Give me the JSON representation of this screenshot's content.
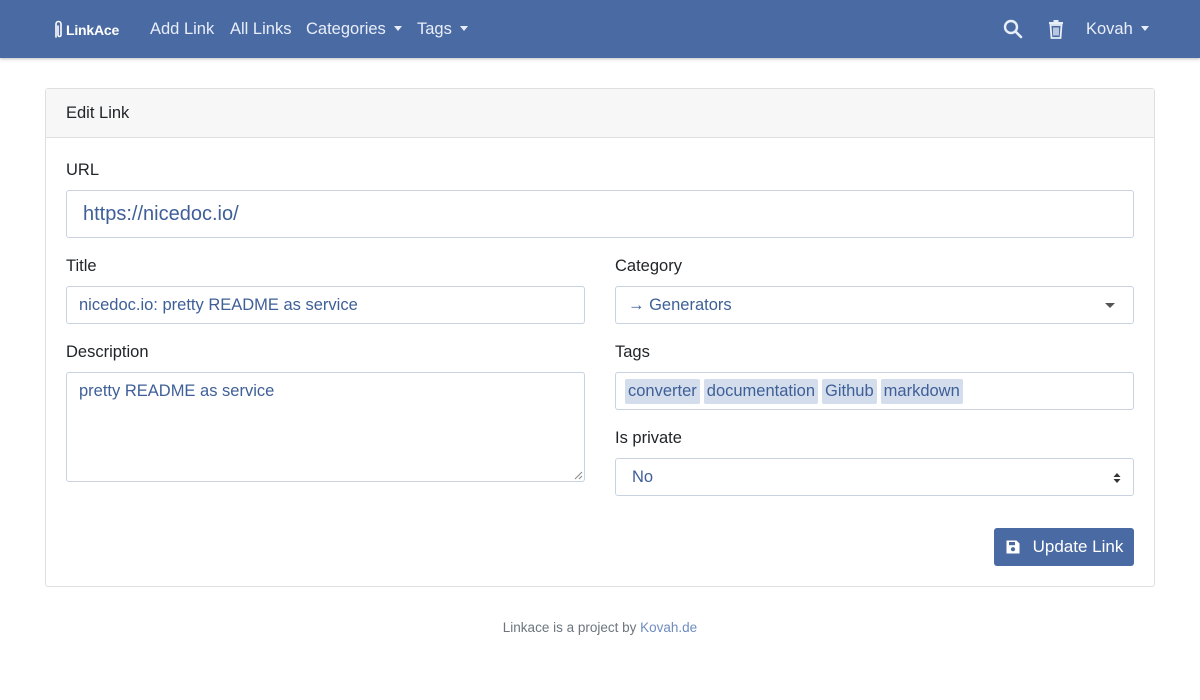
{
  "nav": {
    "brand": "LinkAce",
    "add_link": "Add Link",
    "all_links": "All Links",
    "categories": "Categories",
    "tags": "Tags",
    "user": "Kovah",
    "search_icon": "search-icon",
    "trash_icon": "trash-icon"
  },
  "card": {
    "header": "Edit Link"
  },
  "form": {
    "url": {
      "label": "URL",
      "value": "https://nicedoc.io/"
    },
    "title": {
      "label": "Title",
      "value": "nicedoc.io: pretty README as service"
    },
    "category": {
      "label": "Category",
      "value": "→ Generators"
    },
    "description": {
      "label": "Description",
      "value": "pretty README as service"
    },
    "tags": {
      "label": "Tags",
      "items": [
        "converter",
        "documentation",
        "Github",
        "markdown"
      ]
    },
    "is_private": {
      "label": "Is private",
      "value": "No"
    },
    "submit": "Update Link"
  },
  "footer": {
    "text": "Linkace is a project by",
    "link": "Kovah.de"
  },
  "colors": {
    "navbar": "#4a6aa3",
    "accent_text": "#3e5f97",
    "tag_bg": "#d3ddec"
  }
}
